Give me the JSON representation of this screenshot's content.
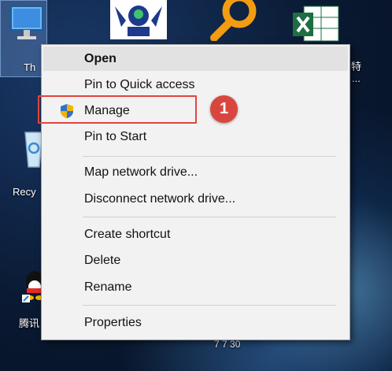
{
  "desktop": {
    "this_pc_label": "Th",
    "recycle_label": "Recy",
    "tencent_label": "腾讯",
    "right_label_1": "特",
    "right_label_2": "...",
    "bottom_text": "7 7 30"
  },
  "menu": {
    "open": "Open",
    "pin_quick_access": "Pin to Quick access",
    "manage": "Manage",
    "pin_start": "Pin to Start",
    "map_network_drive": "Map network drive...",
    "disconnect_network_drive": "Disconnect network drive...",
    "create_shortcut": "Create shortcut",
    "delete": "Delete",
    "rename": "Rename",
    "properties": "Properties"
  },
  "annotation": {
    "step_number": "1",
    "highlight_color": "#e0453e"
  },
  "icons": {
    "this_pc": "monitor-icon",
    "robot": "robot-logo-icon",
    "search": "magnifier-icon",
    "excel": "excel-icon",
    "recycle": "recycle-bin-icon",
    "tencent": "tencent-qq-icon",
    "manage": "uac-shield-icon"
  }
}
